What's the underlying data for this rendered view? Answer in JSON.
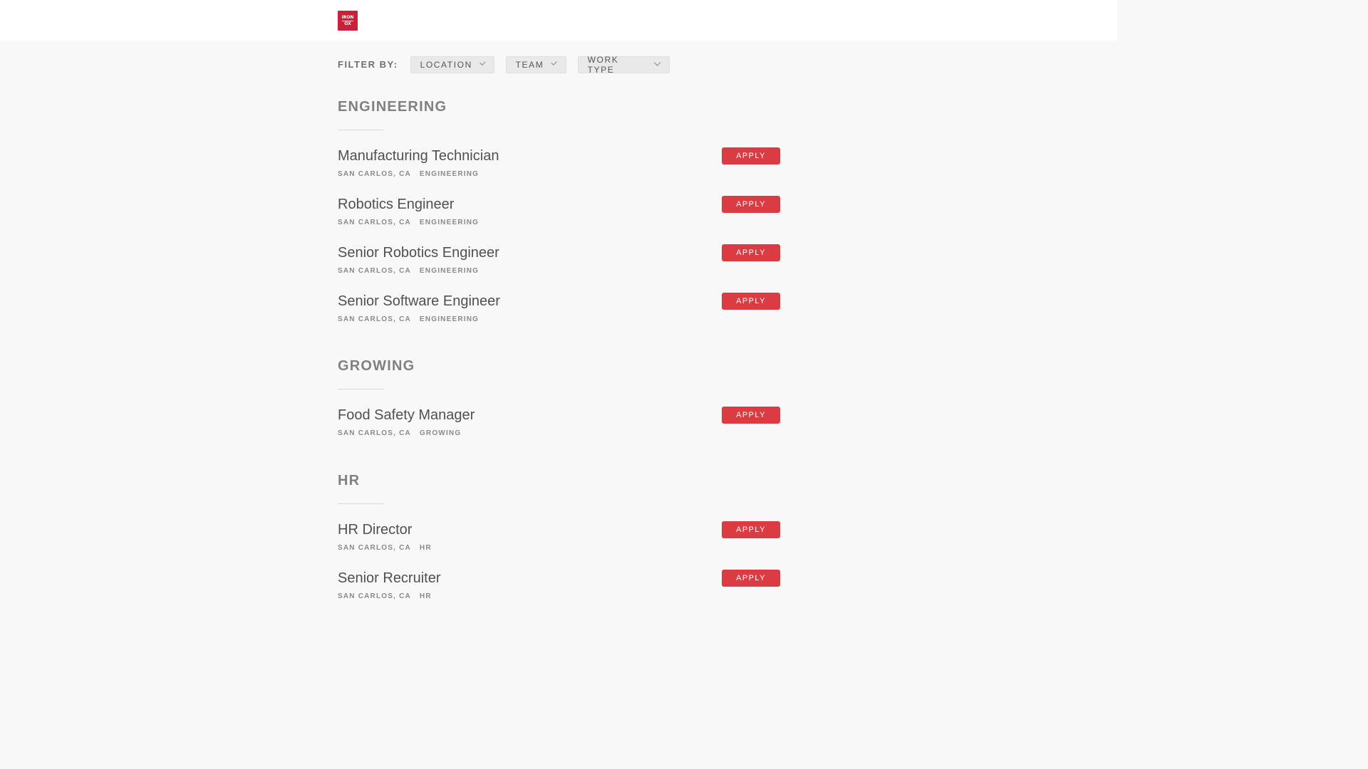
{
  "header": {
    "logo_line1": "IRON",
    "logo_line2": "OX"
  },
  "filter": {
    "label": "FILTER BY:",
    "buttons": [
      "LOCATION",
      "TEAM",
      "WORK TYPE"
    ]
  },
  "sections": [
    {
      "title": "ENGINEERING",
      "postings": [
        {
          "title": "Manufacturing Technician",
          "location": "SAN CARLOS, CA",
          "team": "ENGINEERING",
          "apply": "APPLY"
        },
        {
          "title": "Robotics Engineer",
          "location": "SAN CARLOS, CA",
          "team": "ENGINEERING",
          "apply": "APPLY"
        },
        {
          "title": "Senior Robotics Engineer",
          "location": "SAN CARLOS, CA",
          "team": "ENGINEERING",
          "apply": "APPLY"
        },
        {
          "title": "Senior Software Engineer",
          "location": "SAN CARLOS, CA",
          "team": "ENGINEERING",
          "apply": "APPLY"
        }
      ]
    },
    {
      "title": "GROWING",
      "postings": [
        {
          "title": "Food Safety Manager",
          "location": "SAN CARLOS, CA",
          "team": "GROWING",
          "apply": "APPLY"
        }
      ]
    },
    {
      "title": "HR",
      "postings": [
        {
          "title": "HR Director",
          "location": "SAN CARLOS, CA",
          "team": "HR",
          "apply": "APPLY"
        },
        {
          "title": "Senior Recruiter",
          "location": "SAN CARLOS, CA",
          "team": "HR",
          "apply": "APPLY"
        }
      ]
    }
  ],
  "colors": {
    "brand": "#c8223a",
    "apply_button": "#db3b43",
    "background": "#f8f8f8"
  }
}
